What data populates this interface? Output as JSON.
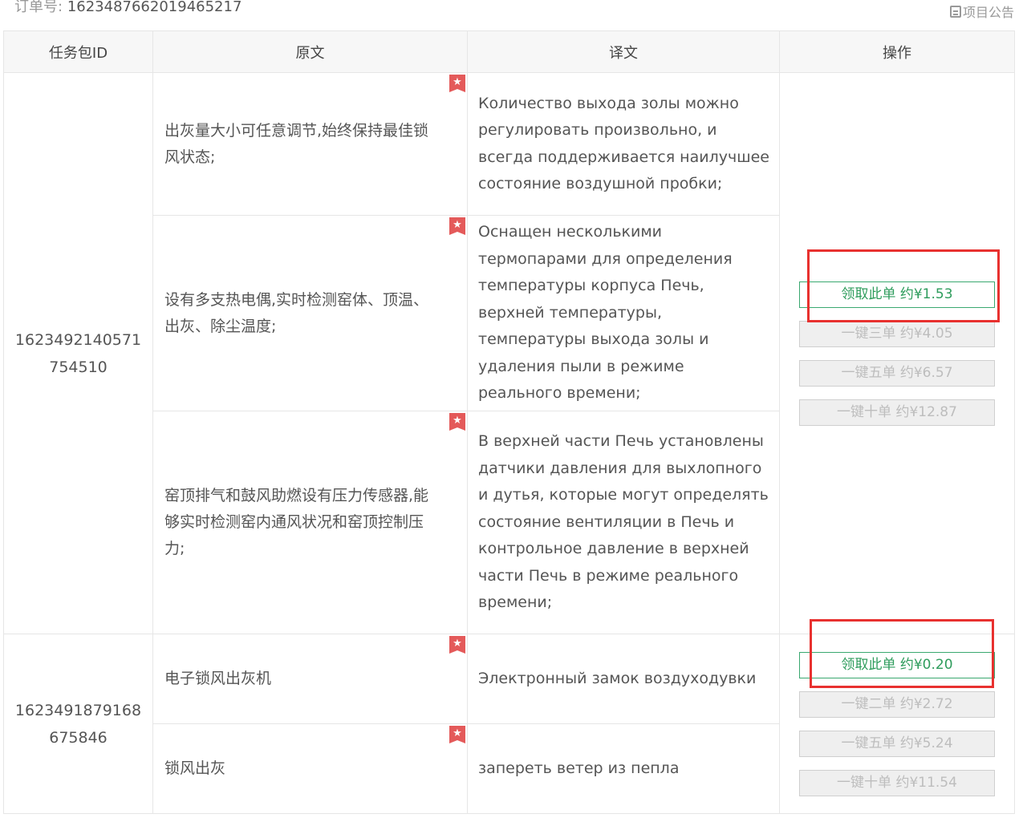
{
  "order": {
    "label": "订单号:",
    "value": "1623487662019465217"
  },
  "notice": {
    "icon": "notice-icon",
    "label": "项目公告"
  },
  "table": {
    "headers": [
      "任务包ID",
      "原文",
      "译文",
      "操作"
    ],
    "packages": [
      {
        "id": "1623492140571754510",
        "rows": [
          {
            "source": "出灰量大小可任意调节,始终保持最佳锁风状态;",
            "target": "Количество выхода золы можно регулировать произвольно, и всегда поддерживается наилучшее состояние воздушной пробки;"
          },
          {
            "source": "设有多支热电偶,实时检测窑体、顶温、出灰、除尘温度;",
            "target": "Оснащен несколькими термопарами для определения температуры корпуса Печь, верхней температуры, температуры выхода золы и удаления пыли в режиме реального времени;"
          },
          {
            "source": "窑顶排气和鼓风助燃设有压力传感器,能够实时检测窑内通风状况和窑顶控制压力;",
            "target": "В верхней части Печь установлены датчики давления для выхлопного и дутья, которые могут определять состояние вентиляции в Печь и контрольное давление в верхней части Печь в режиме реального времени;"
          }
        ],
        "actions": [
          "领取此单 约¥1.53",
          "一键三单 约¥4.05",
          "一键五单 约¥6.57",
          "一键十单 约¥12.87"
        ]
      },
      {
        "id": "1623491879168675846",
        "rows": [
          {
            "source": "电子锁风出灰机",
            "target": "Электронный замок воздуходувки"
          },
          {
            "source": "锁风出灰",
            "target": "запереть ветер из пепла"
          }
        ],
        "actions": [
          "领取此单 约¥0.20",
          "一键二单 约¥2.72",
          "一键五单 约¥5.24",
          "一键十单 约¥11.54"
        ]
      }
    ],
    "star_icon": "★",
    "colors": {
      "primary": "#2e9c5c",
      "highlight": "#e8312f",
      "star": "#e45a5a"
    }
  }
}
